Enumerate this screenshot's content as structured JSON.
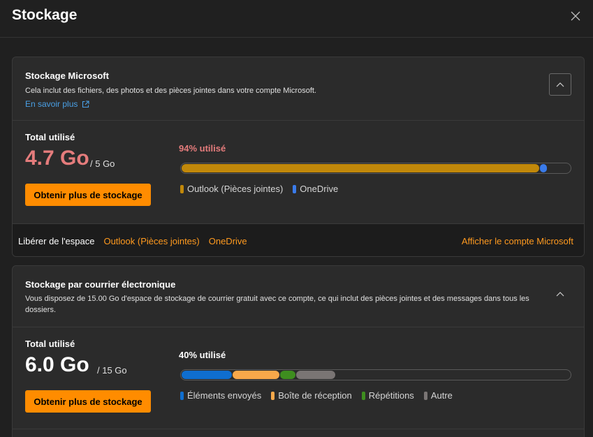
{
  "dialog": {
    "title": "Stockage"
  },
  "microsoft": {
    "title": "Stockage Microsoft",
    "description": "Cela inclut des fichiers, des photos et des pièces jointes dans votre compte Microsoft.",
    "learn_more": "En savoir plus",
    "total_label": "Total utilisé",
    "used": "4.7 Go",
    "capacity": "/ 5 Go",
    "button_label": "Obtenir plus de stockage",
    "percent_label": "94% utilisé",
    "used_color": "#e57c7c",
    "segments": [
      {
        "name": "Outlook (Pièces jointes)",
        "fraction": 0.92,
        "color": "#c1880a"
      },
      {
        "name": "OneDrive",
        "fraction": 0.018,
        "color": "#3a7bea"
      }
    ],
    "free_space_label": "Libérer de l'espace",
    "free_links": [
      "Outlook (Pièces jointes)",
      "OneDrive"
    ],
    "account_link": "Afficher le compte Microsoft"
  },
  "email": {
    "title": "Stockage par courrier électronique",
    "description": "Vous disposez de 15.00 Go d'espace de stockage de courrier gratuit avec ce compte, ce qui inclut des pièces jointes et des messages dans tous les dossiers.",
    "total_label": "Total utilisé",
    "used": "6.0 Go",
    "capacity": "/ 15 Go",
    "button_label": "Obtenir plus de stockage",
    "percent_label": "40% utilisé",
    "used_color": "#ffffff",
    "segments": [
      {
        "name": "Éléments envoyés",
        "fraction": 0.13,
        "color": "#0f6ecf"
      },
      {
        "name": "Boîte de réception",
        "fraction": 0.12,
        "color": "#f8a84a"
      },
      {
        "name": "Répétitions",
        "fraction": 0.04,
        "color": "#3e8e1f"
      },
      {
        "name": "Autre",
        "fraction": 0.1,
        "color": "#7a7574"
      }
    ]
  },
  "icons": {
    "close": "close-icon",
    "external": "external-link-icon",
    "collapse": "chevron-up-icon"
  }
}
